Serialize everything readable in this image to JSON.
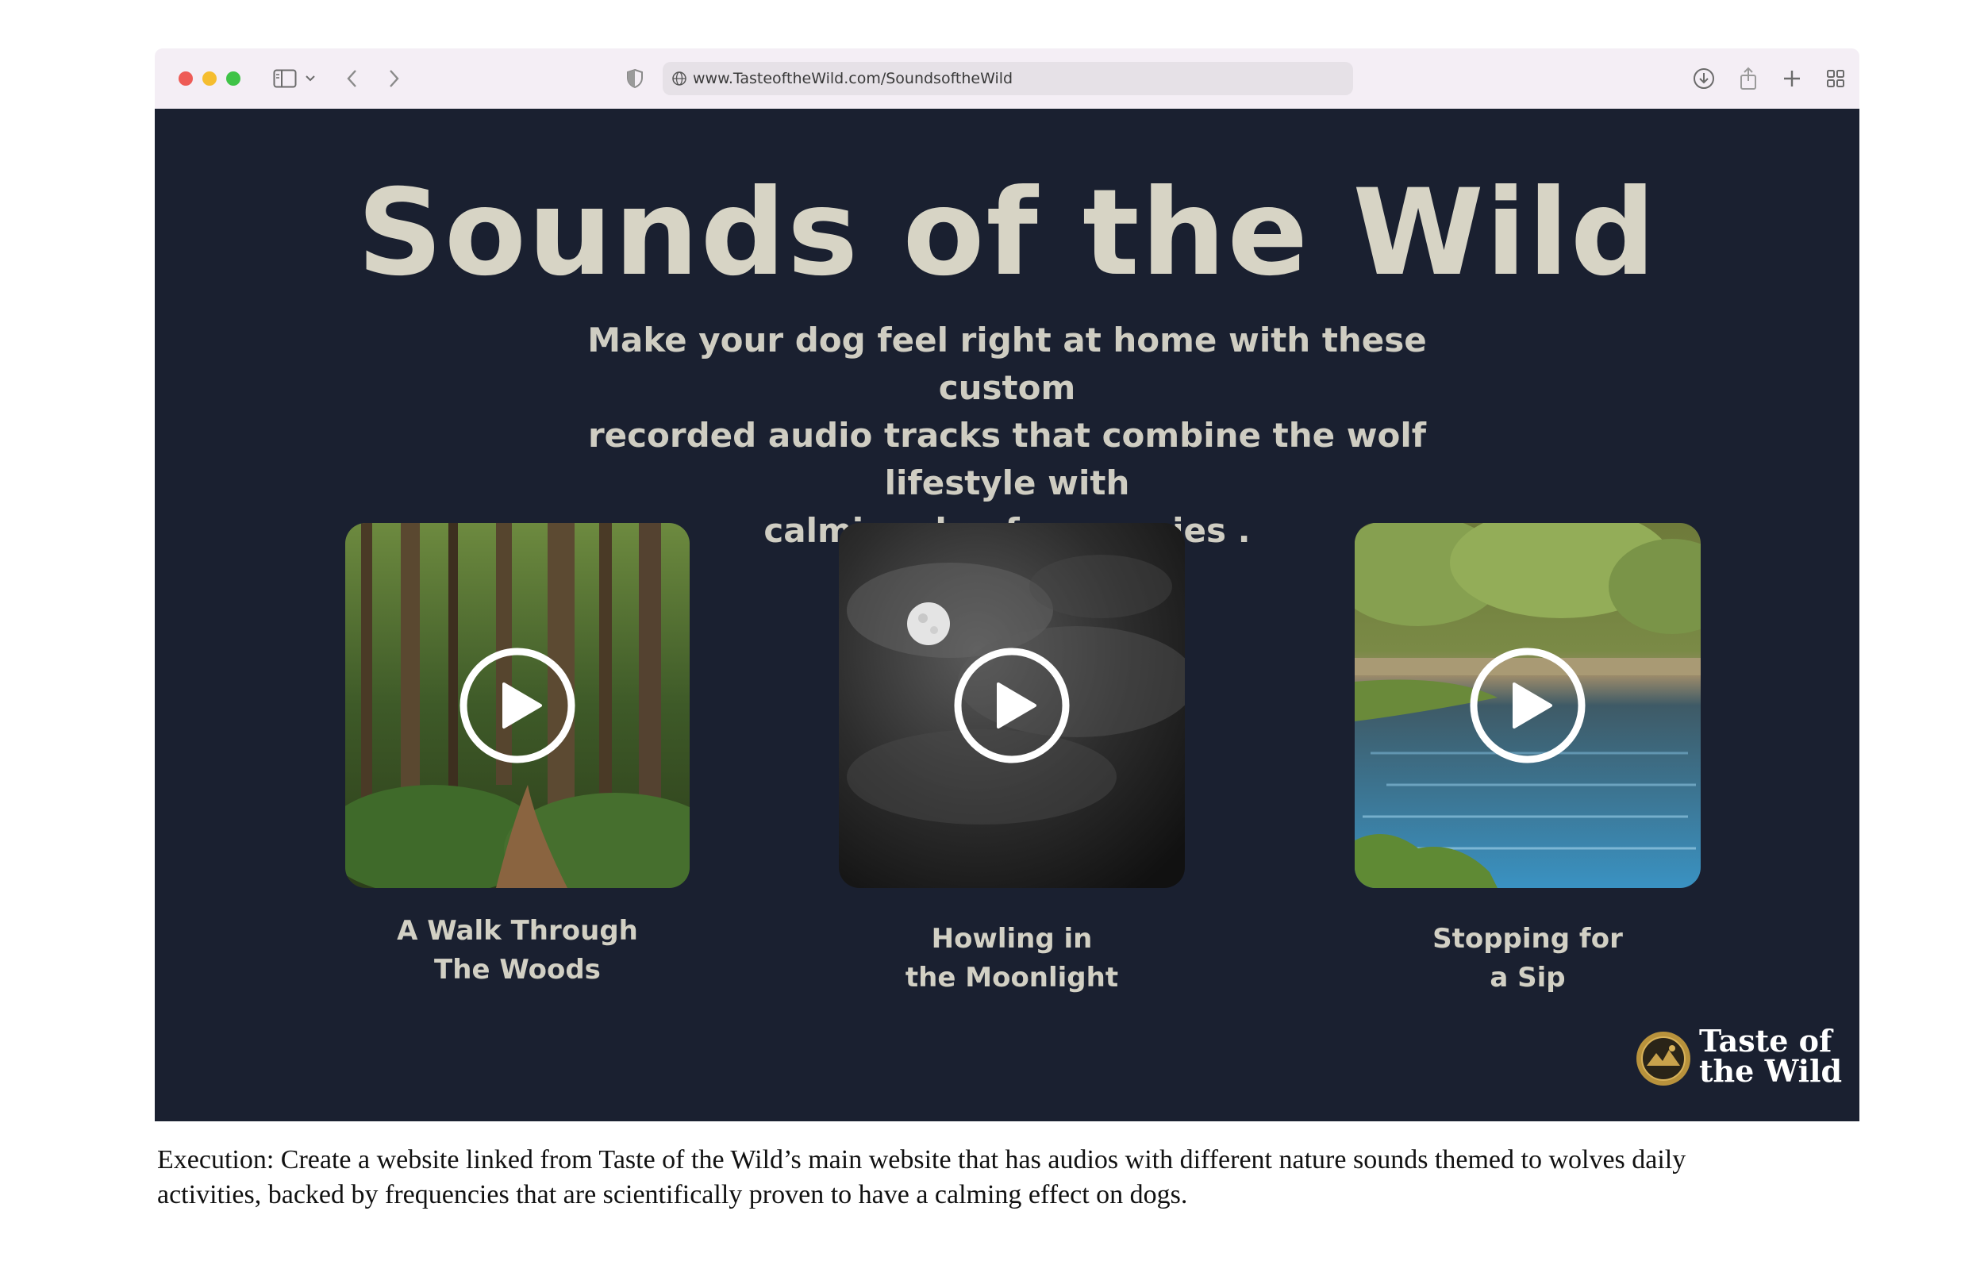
{
  "browser": {
    "url": "www.TasteoftheWild.com/SoundsoftheWild",
    "icons": [
      "sidebar-icon",
      "chevron-down-icon",
      "back-icon",
      "forward-icon",
      "shield-icon",
      "globe-icon",
      "download-icon",
      "share-icon",
      "new-tab-icon",
      "tab-overview-icon"
    ]
  },
  "page": {
    "title": "Sounds of the Wild",
    "subtitle_lines": [
      "Make your dog feel right at home with these custom",
      "recorded audio tracks that combine the wolf lifestyle with",
      "calming dog frequencies ."
    ],
    "tracks": [
      {
        "label_line1": "A Walk Through",
        "label_line2": "The Woods",
        "image": "forest"
      },
      {
        "label_line1": "Howling in",
        "label_line2": "the Moonlight",
        "image": "moon"
      },
      {
        "label_line1": "Stopping for",
        "label_line2": "a Sip",
        "image": "lake"
      }
    ],
    "logo": {
      "line1": "Taste of",
      "line2": "the Wild"
    }
  },
  "caption": {
    "line1": "Execution: Create a website linked from Taste of the Wild’s main website that has audios with different nature sounds themed to wolves daily",
    "line2": "activities, backed by frequencies that are scientifically proven to have a calming effect on dogs."
  },
  "colors": {
    "page_bg": "#1a2030",
    "title": "#d7d4c5",
    "toolbar": "#f4eef5",
    "close": "#ee5b56",
    "minimize": "#f5bd2f",
    "zoom": "#3fc347"
  }
}
